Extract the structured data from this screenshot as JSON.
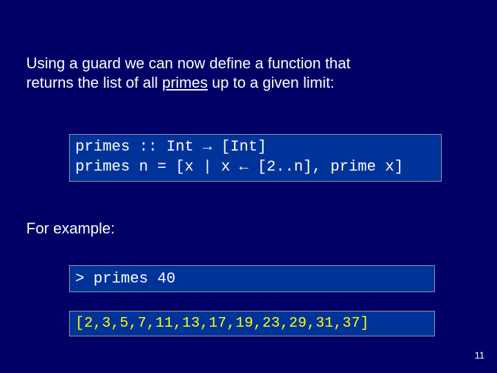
{
  "intro": {
    "line1_a": "Using a guard we can now define a function that",
    "line1_b": "returns the list of all ",
    "primes_word": "primes",
    "line1_c": " up to a given limit:"
  },
  "code_def": {
    "l1a": "primes   :: Int ",
    "arrow1": "→",
    "l1b": " [Int]",
    "l2a": "primes n = [x | x ",
    "arrow2": "←",
    "l2b": " [2..n], prime x]"
  },
  "for_example": "For example:",
  "code_call": "> primes 40",
  "code_result": "[2,3,5,7,11,13,17,19,23,29,31,37]",
  "page_number": "11"
}
